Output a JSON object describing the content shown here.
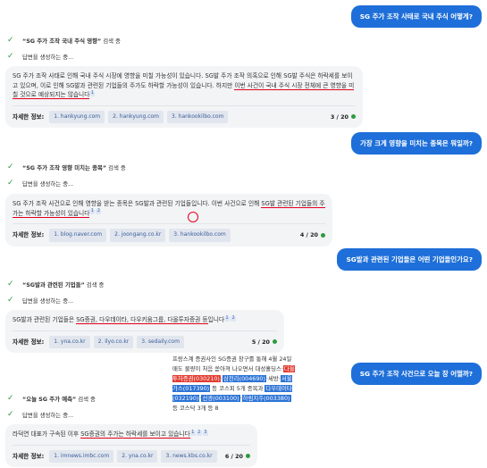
{
  "q1": {
    "text": "SG 주가 조작 사태로 국내 주식 어떻게?"
  },
  "s1": {
    "query": "“SG 주가 조작 국내 주식 영향”",
    "suffix": " 검색 중",
    "gen": "답변을 생성하는 중..."
  },
  "a1": {
    "text_plain": "SG 주가 조작 사태로 인해 국내 주식 시장에 영향을 미칠 가능성이 있습니다. SG발 주가 조작 의혹으로 인해 SG발 주식은 하락세를 보이고 있으며, 이로 인해 SG발과 관련된 기업들의 주가도 하락할 가능성이 있습니다. 하지만 ",
    "text_ul": "이번 사건이 국내 주식 시장 전체에 큰 영향을 미칠 것으로 예상되지는 않습니다",
    "refs": [
      "1"
    ],
    "sources_label": "자세한 정보:",
    "sources": [
      "1. hankyung.com",
      "2. hankyung.com",
      "3. hankookilbo.com"
    ],
    "page": "3 / 20"
  },
  "q2": {
    "text": "가장 크게 영향을 미치는 종목은 뭐일까?"
  },
  "s2": {
    "query": "“SG 주가 조작 영향 미치는 종목”",
    "suffix": " 검색 중",
    "gen": "답변을 생성하는 중..."
  },
  "a2": {
    "text_plain": "SG 주가 조작 사건으로 인해 영향을 받는 종목은 SG발과 관련된 기업들입니다. 이번 사건으로 인해 ",
    "text_ul": "SG발 관련된 기업들의 주가는 하락할 가능성이 있습니다",
    "refs": [
      "1",
      "2"
    ],
    "sources_label": "자세한 정보:",
    "sources": [
      "1. blog.naver.com",
      "2. joongang.co.kr",
      "3. hankookilbo.com"
    ],
    "page": "4 / 20"
  },
  "q3": {
    "text": "SG발과 관련된 기업들은 어떤 기업들인가요?"
  },
  "s3": {
    "query": "“SG발과 관련된 기업들”",
    "suffix": " 검색 중",
    "gen": "답변을 생성하는 중..."
  },
  "a3": {
    "text_plain": "SG발과 관련된 기업들은 ",
    "text_ul": "SG증권, 다우데이타, 다우키움그룹, 다올투자증권 등",
    "text_end": "입니다",
    "refs": [
      "1",
      "2"
    ],
    "sources_label": "자세한 정보:",
    "sources": [
      "1. yna.co.kr",
      "2. ilyo.co.kr",
      "3. sedaily.com"
    ],
    "page": "5 / 20"
  },
  "q4": {
    "text": "SG 주가 조작 사건으로 오늘 장 어떨까?"
  },
  "stocks": {
    "intro": "프랑스계 증권사인 SG증권 창구를 통해 4월 24일 매도 물량이 처음 쏟아져 나오면서 대성홀딩스·",
    "t1": "다올투자증권(030210)",
    "sep1": "·",
    "t2": "삼천리(004690)",
    "sep2": "·세방·",
    "t3": "서울가스(017390)",
    "mid": " 등 코스피 5개 종목과 ",
    "t4": "다우데이타(032190)",
    "sep3": "·",
    "t5": "선광(003100)",
    "sep4": "·",
    "t6": "하림지주(003380)",
    "end": " 등 코스닥 3개 등 8"
  },
  "s4": {
    "query": "“오늘 SG 주가 예측”",
    "suffix": " 검색 중",
    "gen": "답변을 생성하는 중..."
  },
  "a4": {
    "text_plain": "라덕연 대표가 구속된 이후 ",
    "text_ul": "SG증권의 주가는 하락세를 보이고 있습니다",
    "refs": [
      "1",
      "2",
      "3"
    ],
    "sources_label": "자세한 정보:",
    "sources": [
      "1. imnews.imbc.com",
      "2. yna.co.kr",
      "3. news.kbs.co.kr"
    ],
    "page": "6 / 20"
  }
}
